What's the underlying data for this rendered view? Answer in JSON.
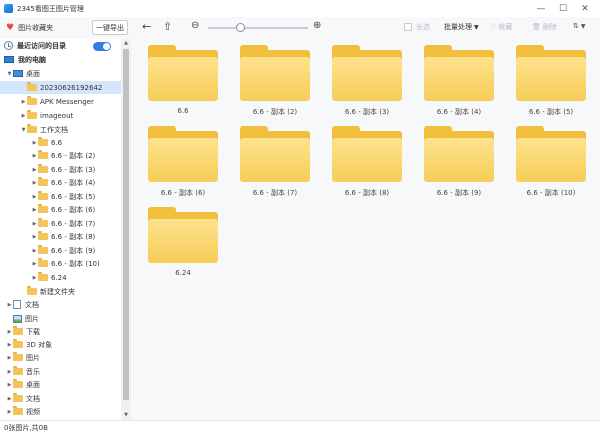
{
  "window": {
    "title": "2345看图王图片管理"
  },
  "toolbar": {
    "favorites_label": "图片收藏夹",
    "export_label": "一键导出",
    "select_all_label": "全选",
    "batch_label": "批量处理",
    "favorite_label": "收藏",
    "delete_label": "删除"
  },
  "sidebar": {
    "recent_label": "最近访问的目录",
    "my_pc_label": "我的电脑",
    "desktop_label": "桌面",
    "items": [
      "20230626192642",
      "APK Messenger",
      "imageout",
      "工作文档",
      "6.6",
      "6.6 - 副本 (2)",
      "6.6 - 副本 (3)",
      "6.6 - 副本 (4)",
      "6.6 - 副本 (5)",
      "6.6 - 副本 (6)",
      "6.6 - 副本 (7)",
      "6.6 - 副本 (8)",
      "6.6 - 副本 (9)",
      "6.6 - 副本 (10)",
      "6.24",
      "新建文件夹"
    ],
    "root_items": [
      "文档",
      "图片",
      "下载",
      "3D 对象",
      "图片",
      "音乐",
      "桌面",
      "文档",
      "视频"
    ]
  },
  "folders": [
    "6.6",
    "6.6 - 副本 (2)",
    "6.6 - 副本 (3)",
    "6.6 - 副本 (4)",
    "6.6 - 副本 (5)",
    "6.6 - 副本 (6)",
    "6.6 - 副本 (7)",
    "6.6 - 副本 (8)",
    "6.6 - 副本 (9)",
    "6.6 - 副本 (10)",
    "6.24"
  ],
  "status": {
    "text": "0张图片,共0B"
  },
  "colors": {
    "accent": "#2f7fe5",
    "folder": "#f7cd5a",
    "selected": "#d3e6fb"
  }
}
